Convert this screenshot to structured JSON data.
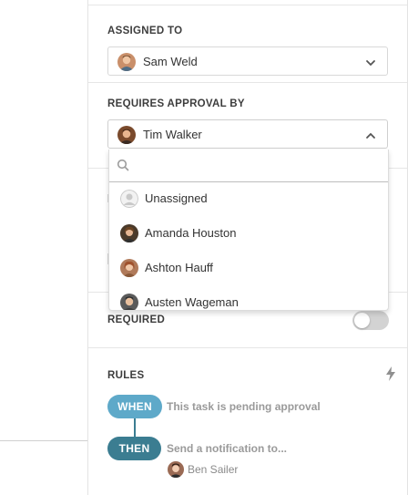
{
  "assigned_to": {
    "label": "ASSIGNED TO",
    "value": "Sam Weld",
    "avatar_icon": "user-avatar-sam-weld"
  },
  "requires_approval": {
    "label": "REQUIRES APPROVAL BY",
    "value": "Tim Walker",
    "avatar_icon": "user-avatar-tim-walker",
    "dropdown": {
      "search_placeholder": "",
      "options": [
        {
          "name": "Unassigned",
          "avatar_icon": "placeholder-user-icon"
        },
        {
          "name": "Amanda Houston",
          "avatar_icon": "user-avatar-amanda-houston"
        },
        {
          "name": "Ashton Hauff",
          "avatar_icon": "user-avatar-ashton-hauff"
        },
        {
          "name": "Austen Wageman",
          "avatar_icon": "user-avatar-austen-wageman"
        }
      ]
    }
  },
  "required": {
    "label": "REQUIRED",
    "enabled": false
  },
  "rules": {
    "label": "RULES",
    "when_label": "WHEN",
    "when_text": "This task is pending approval",
    "then_label": "THEN",
    "then_text": "Send a notification to...",
    "recipient": "Ben Sailer",
    "icon": "lightning-bolt-icon"
  },
  "colors": {
    "when_pill": "#5ea9c9",
    "then_pill": "#3b7d91",
    "toggle_off": "#d3d3d3"
  }
}
